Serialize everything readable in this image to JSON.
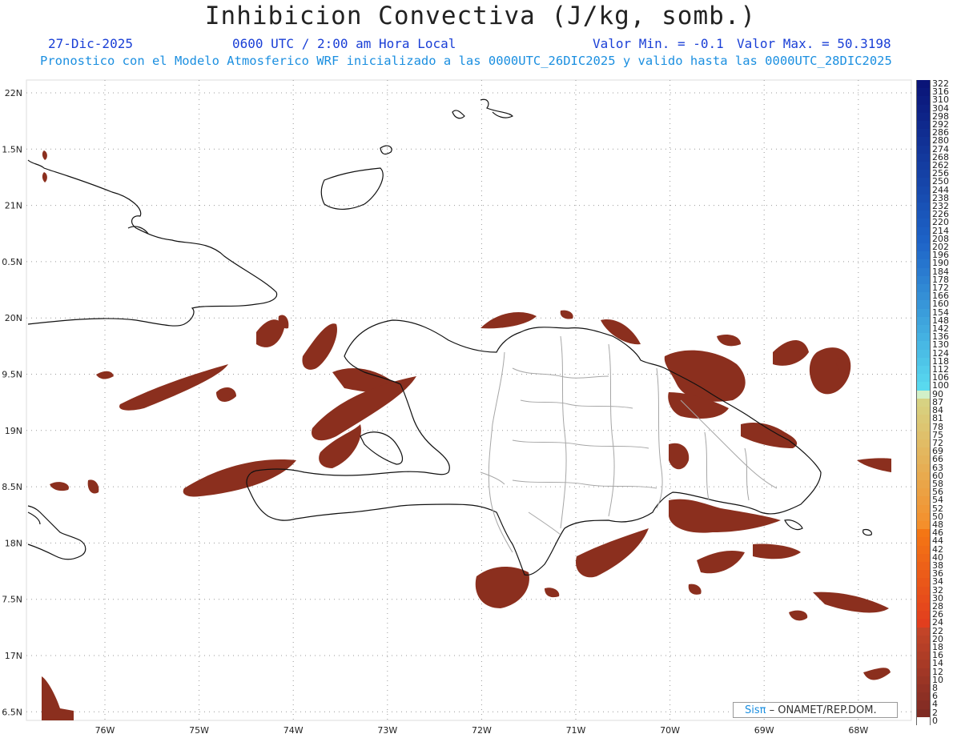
{
  "header": {
    "title": "Inhibicion Convectiva (J/kg, somb.)",
    "date": "27-Dic-2025",
    "time": "0600 UTC / 2:00 am Hora Local",
    "min_label": "Valor Min. = -0.1",
    "max_label": "Valor Max. = 50.3198",
    "description": "Pronostico con el Modelo Atmosferico WRF inicializado a las 0000UTC_26DIC2025 y valido hasta las  0000UTC_28DIC2025"
  },
  "map": {
    "lat_labels": [
      "22N",
      "1.5N",
      "21N",
      "0.5N",
      "20N",
      "9.5N",
      "19N",
      "8.5N",
      "18N",
      "7.5N",
      "17N",
      "6.5N"
    ],
    "lon_labels": [
      "76W",
      "75W",
      "74W",
      "73W",
      "72W",
      "71W",
      "70W",
      "69W",
      "68W"
    ],
    "shade_color": "#8b2f1e",
    "coast_color": "#111111",
    "border_color": "#a6a6a6"
  },
  "colorbar": {
    "labels": [
      "322",
      "316",
      "310",
      "304",
      "298",
      "292",
      "286",
      "280",
      "274",
      "268",
      "262",
      "256",
      "250",
      "244",
      "238",
      "232",
      "226",
      "220",
      "214",
      "208",
      "202",
      "196",
      "190",
      "184",
      "178",
      "172",
      "166",
      "160",
      "154",
      "148",
      "142",
      "136",
      "130",
      "124",
      "118",
      "112",
      "106",
      "100",
      "90",
      "87",
      "84",
      "81",
      "78",
      "75",
      "72",
      "69",
      "66",
      "63",
      "60",
      "58",
      "56",
      "54",
      "52",
      "50",
      "48",
      "46",
      "44",
      "42",
      "40",
      "38",
      "36",
      "34",
      "32",
      "30",
      "28",
      "26",
      "24",
      "22",
      "20",
      "18",
      "16",
      "14",
      "12",
      "10",
      "8",
      "6",
      "4",
      "2",
      "0"
    ]
  },
  "credit": {
    "sis": "Sisπ",
    "text": "– ONAMET/REP.DOM."
  }
}
